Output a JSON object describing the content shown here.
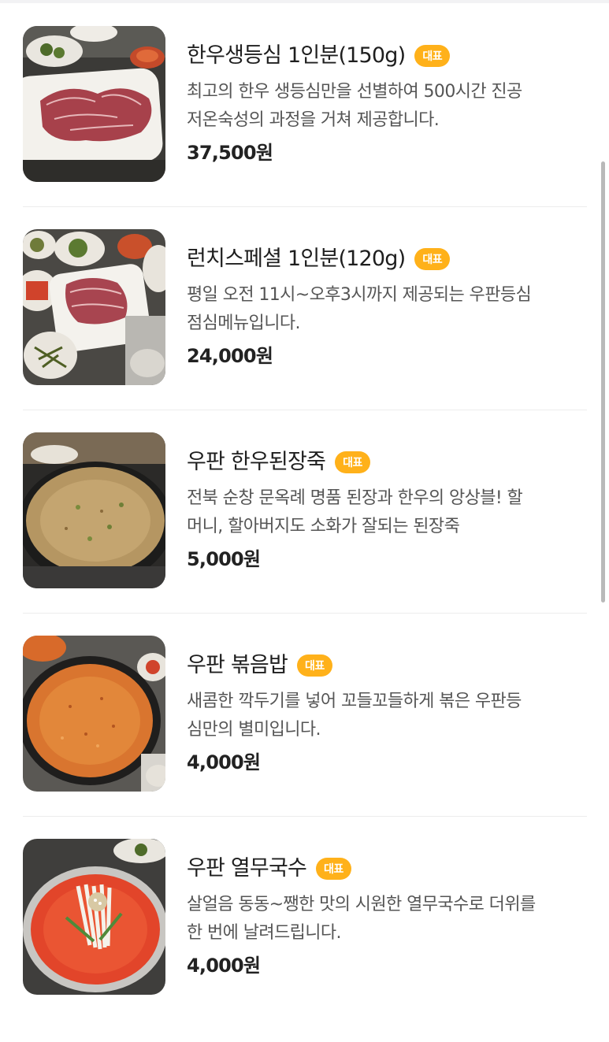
{
  "menu": [
    {
      "name": "한우생등심 1인분(150g)",
      "badge": "대표",
      "description": "최고의 한우 생등심만을 선별하여 500시간 진공\n저온숙성의 과정을 거쳐 제공합니다.",
      "price": "37,500원",
      "photo_icon": "sliced-beef-photo"
    },
    {
      "name": "런치스페셜 1인분(120g)",
      "badge": "대표",
      "description": "평일 오전 11시~오후3시까지 제공되는 우판등심\n점심메뉴입니다.",
      "price": "24,000원",
      "photo_icon": "lunch-beef-photo"
    },
    {
      "name": "우판 한우된장죽",
      "badge": "대표",
      "description": "전북 순창 문옥례 명품 된장과 한우의 앙상블! 할\n머니, 할아버지도 소화가 잘되는 된장죽",
      "price": "5,000원",
      "photo_icon": "soybean-porridge-photo"
    },
    {
      "name": "우판 볶음밥",
      "badge": "대표",
      "description": "새콤한 깍두기를 넣어 꼬들꼬들하게 볶은 우판등\n심만의 별미입니다.",
      "price": "4,000원",
      "photo_icon": "fried-rice-photo"
    },
    {
      "name": "우판 열무국수",
      "badge": "대표",
      "description": "살얼음 동동~쨍한 맛의 시원한 열무국수로 더위를\n한 번에 날려드립니다.",
      "price": "4,000원",
      "photo_icon": "cold-noodle-photo"
    }
  ],
  "colors": {
    "badge": "#ffb11a",
    "title": "#1e1e1e",
    "description": "#555555",
    "price": "#222222",
    "divider": "#ececec"
  }
}
